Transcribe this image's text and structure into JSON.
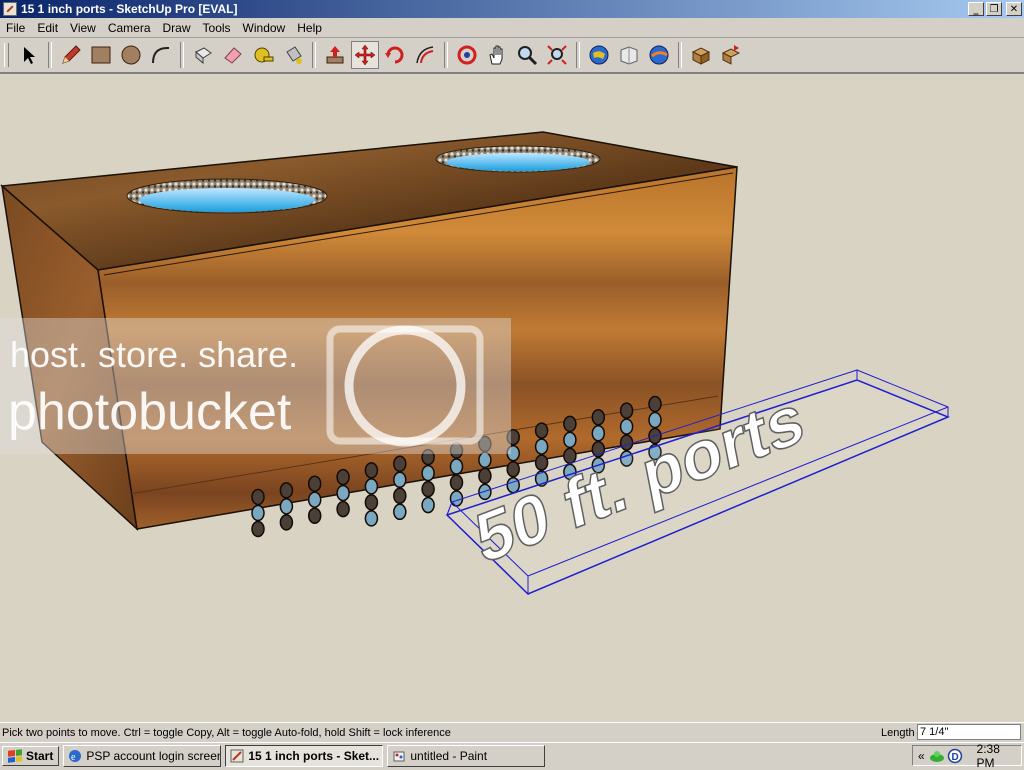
{
  "window": {
    "title": "15 1 inch ports - SketchUp Pro [EVAL]",
    "controls": [
      "_",
      "❐",
      "✕"
    ]
  },
  "menu": [
    "File",
    "Edit",
    "View",
    "Camera",
    "Draw",
    "Tools",
    "Window",
    "Help"
  ],
  "toolbar": {
    "tools": [
      {
        "name": "select-icon"
      },
      {
        "name": "pencil-icon"
      },
      {
        "name": "rectangle-icon"
      },
      {
        "name": "circle-icon"
      },
      {
        "name": "arc-icon"
      },
      {
        "name": "make-component-icon"
      },
      {
        "name": "eraser-icon"
      },
      {
        "name": "tape-measure-icon"
      },
      {
        "name": "paint-bucket-icon"
      },
      {
        "name": "push-pull-icon"
      },
      {
        "name": "move-icon"
      },
      {
        "name": "rotate-icon"
      },
      {
        "name": "offset-icon"
      },
      {
        "name": "orbit-icon"
      },
      {
        "name": "pan-icon"
      },
      {
        "name": "zoom-icon"
      },
      {
        "name": "zoom-extents-icon"
      },
      {
        "name": "get-models-icon"
      },
      {
        "name": "share-model-icon"
      },
      {
        "name": "google-earth-icon"
      },
      {
        "name": "get-component-icon"
      },
      {
        "name": "share-component-icon"
      }
    ],
    "active_tool": "move-icon"
  },
  "viewport": {
    "model_text": "50 ft. ports",
    "watermark_line1": "host. store. share.",
    "watermark_line2": "photobucket"
  },
  "status": {
    "message": "Pick two points to move.  Ctrl = toggle Copy, Alt = toggle Auto-fold, hold Shift = lock inference",
    "length_label": "Length",
    "length_value": "7 1/4\""
  },
  "taskbar": {
    "start_label": "Start",
    "tasks": [
      {
        "label": "PSP account login screen...",
        "active": false
      },
      {
        "label": "15 1 inch ports - Sket...",
        "active": true
      },
      {
        "label": "untitled - Paint",
        "active": false
      }
    ],
    "tray_chevron": "«",
    "clock": "2:38 PM"
  },
  "colors": {
    "title_gradient_start": "#0a246a",
    "viewport_bg": "#d9d3c3",
    "selection_blue": "#1f1fd0"
  }
}
